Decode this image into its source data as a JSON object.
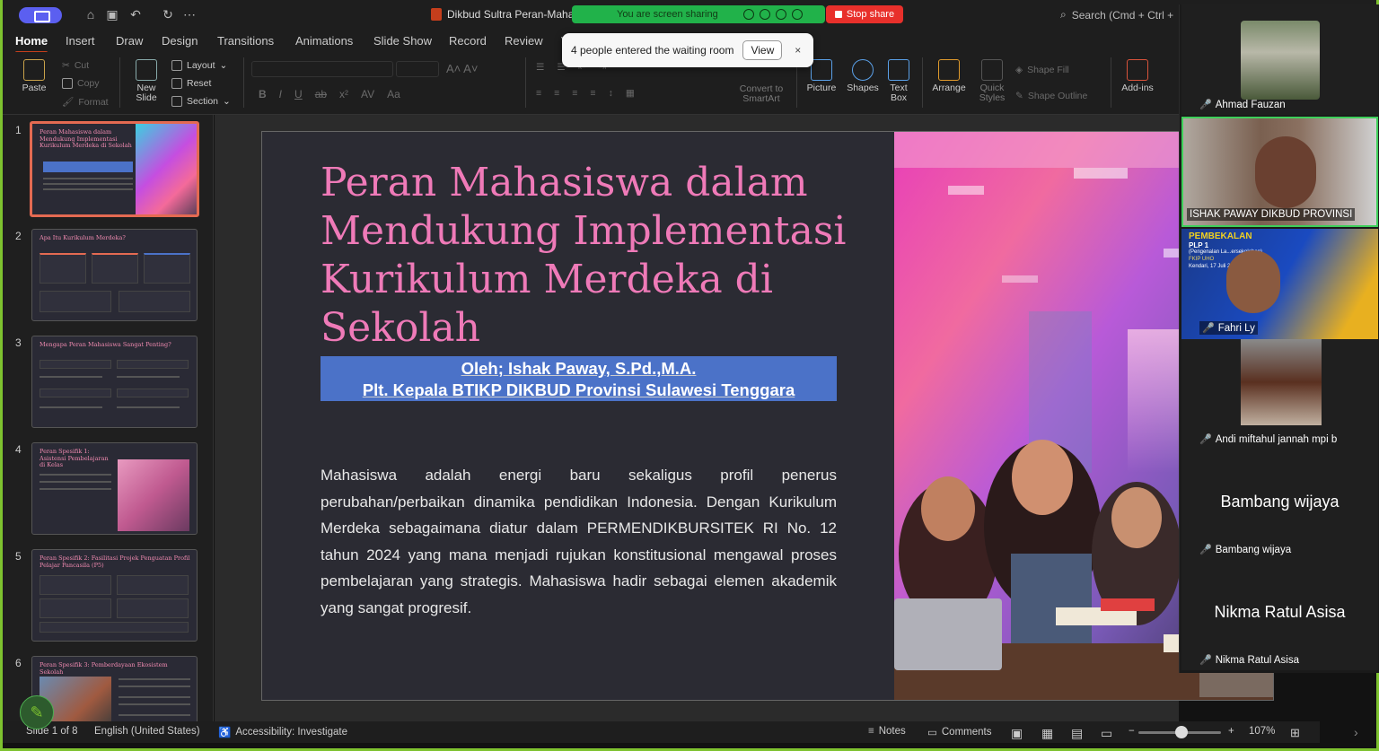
{
  "window": {
    "doc_title": "Dikbud Sultra Peran-Mahas",
    "search_label": "Search (Cmd + Ctrl +",
    "screen_share_status": "You are screen sharing",
    "stop_share_label": "Stop share"
  },
  "toast": {
    "message": "4 people entered the waiting room",
    "view_label": "View",
    "close_label": "×"
  },
  "tabs": [
    "Home",
    "Insert",
    "Draw",
    "Design",
    "Transitions",
    "Animations",
    "Slide Show",
    "Record",
    "Review",
    "V"
  ],
  "ribbon": {
    "paste": "Paste",
    "cut": "Cut",
    "copy": "Copy",
    "format": "Format",
    "new_slide_1": "New",
    "new_slide_2": "Slide",
    "layout": "Layout",
    "reset": "Reset",
    "section": "Section",
    "convert_1": "Convert to",
    "convert_2": "SmartArt",
    "picture": "Picture",
    "shapes": "Shapes",
    "textbox_1": "Text",
    "textbox_2": "Box",
    "arrange": "Arrange",
    "quick_styles_1": "Quick",
    "quick_styles_2": "Styles",
    "shape_fill": "Shape Fill",
    "shape_outline": "Shape Outline",
    "addins": "Add-ins"
  },
  "thumbnails": [
    {
      "num": "1",
      "title": "Peran Mahasiswa dalam Mendukung Implementasi Kurikulum Merdeka di Sekolah"
    },
    {
      "num": "2",
      "title": "Apa Itu Kurikulum Merdeka?"
    },
    {
      "num": "3",
      "title": "Mengapa Peran Mahasiswa Sangat Penting?"
    },
    {
      "num": "4",
      "title": "Peran Spesifik 1: Asistensi Pembelajaran di Kelas"
    },
    {
      "num": "5",
      "title": "Peran Spesifik 2: Fasilitasi Projek Penguatan Profil Pelajar Pancasila (P5)"
    },
    {
      "num": "6",
      "title": "Peran Spesifik 3: Pemberdayaan Ekosistem Sekolah"
    }
  ],
  "slide": {
    "title": "Peran Mahasiswa dalam Mendukung Implementasi Kurikulum Merdeka di Sekolah",
    "byline_1": "Oleh; Ishak Paway, S.Pd.,M.A.",
    "byline_2": "Plt. Kepala BTIKP DIKBUD Provinsi Sulawesi Tenggara",
    "body": "Mahasiswa adalah energi baru sekaligus profil penerus perubahan/perbaikan dinamika pendidikan Indonesia. Dengan Kurikulum Merdeka sebagaimana diatur dalam PERMENDIKBURSITEK RI No. 12 tahun 2024 yang mana menjadi rujukan konstitusional mengawal proses pembelajaran yang strategis. Mahasiswa hadir sebagai elemen akademik yang sangat progresif."
  },
  "participants": [
    {
      "name": "Ahmad Fauzan",
      "speaking": false,
      "video": true
    },
    {
      "name": "ISHAK PAWAY DIKBUD PROVINSI",
      "speaking": true,
      "video": true
    },
    {
      "name": "Fahri Ly",
      "speaking": false,
      "video": true,
      "banner_1": "PEMBEKALAN",
      "banner_2": "PLP 1",
      "banner_3": "(Pengenalan La...ersekolahan)",
      "banner_4": "FKIP UHO",
      "banner_5": "Kendari, 17 Juli 2..."
    },
    {
      "name": "Andi miftahul jannah mpi b",
      "speaking": false,
      "video": true
    },
    {
      "name": "Bambang wijaya",
      "speaking": false,
      "video": false
    },
    {
      "name": "Nikma Ratul Asisa",
      "speaking": false,
      "video": false
    }
  ],
  "statusbar": {
    "slide_count": "Slide 1 of 8",
    "language": "English (United States)",
    "accessibility": "Accessibility: Investigate",
    "notes": "Notes",
    "comments": "Comments",
    "zoom": "107%"
  },
  "colors": {
    "accent_orange": "#c43e1c",
    "share_green": "#21b24a",
    "stop_red": "#e8302b",
    "title_pink": "#ef7ab8",
    "byline_blue": "#4b72c8",
    "speaking_green": "#3ecf5a"
  }
}
